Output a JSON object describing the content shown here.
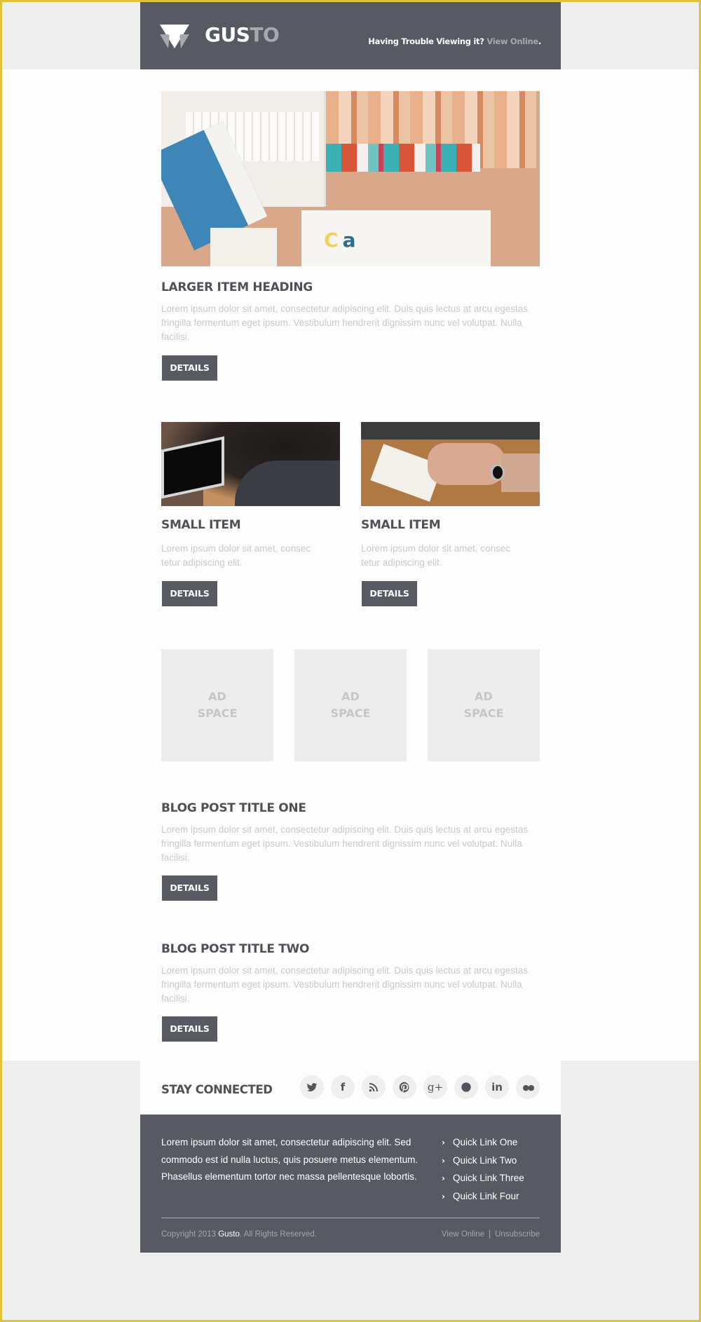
{
  "header": {
    "brand_bright": "GUS",
    "brand_dim": "TO",
    "trouble_text": "Having Trouble Viewing it?",
    "view_online_link": "View Online",
    "trailing_period": "."
  },
  "hero": {
    "heading": "LARGER ITEM HEADING",
    "body": "Lorem ipsum dolor sit amet, consectetur adipiscing elit. Duis quis lectus at arcu egestas fringilla fermentum eget ipsum. Vestibulum hendrerit dignissim nunc vel volutpat. Nulla facilisi.",
    "button": "DETAILS"
  },
  "small_items": [
    {
      "heading": "SMALL ITEM",
      "body": "Lorem ipsum dolor sit amet, consec tetur adipiscing elit.",
      "button": "DETAILS"
    },
    {
      "heading": "SMALL ITEM",
      "body": "Lorem ipsum dolor sit amet, consec tetur adipiscing elit.",
      "button": "DETAILS"
    }
  ],
  "ads": [
    {
      "line1": "AD",
      "line2": "SPACE"
    },
    {
      "line1": "AD",
      "line2": "SPACE"
    },
    {
      "line1": "AD",
      "line2": "SPACE"
    }
  ],
  "blog_posts": [
    {
      "title": "BLOG POST TITLE ONE",
      "body": "Lorem ipsum dolor sit amet, consectetur adipiscing elit. Duis quis lectus at arcu egestas fringilla fermentum eget ipsum. Vestibulum hendrerit dignissim nunc vel volutpat. Nulla facilisi.",
      "button": "DETAILS"
    },
    {
      "title": "BLOG POST TITLE TWO",
      "body": "Lorem ipsum dolor sit amet, consectetur adipiscing elit. Duis quis lectus at arcu egestas fringilla fermentum eget ipsum. Vestibulum hendrerit dignissim nunc vel volutpat. Nulla facilisi.",
      "button": "DETAILS"
    }
  ],
  "social": {
    "heading": "STAY CONNECTED",
    "icons": [
      "twitter-icon",
      "facebook-icon",
      "rss-icon",
      "pinterest-icon",
      "google-plus-icon",
      "dribbble-icon",
      "linkedin-icon",
      "flickr-icon"
    ],
    "facebook_glyph": "f",
    "google_glyph": "g+",
    "linkedin_glyph": "in",
    "flickr_glyph": "●●"
  },
  "footer": {
    "about": "Lorem ipsum dolor sit amet, consectetur adipiscing elit. Sed commodo est id nulla luctus, quis posuere metus elementum. Phasellus elementum tortor nec massa pellentesque lobortis.",
    "quick_links": [
      "Quick Link One",
      "Quick Link Two",
      "Quick Link Three",
      "Quick Link Four"
    ],
    "chevron": "›",
    "copyright_prefix": "Copyright 2013",
    "copyright_brand": "Gusto",
    "copyright_suffix": ". All Rights Reserved.",
    "view_online": "View Online",
    "separator": "|",
    "unsubscribe": "Unsubscribe"
  },
  "colors": {
    "header_bg": "#585a63",
    "page_bg": "#eeeeee",
    "content_bg": "#fdfdfd",
    "frame_border": "#dfc33a",
    "heading": "#4f5157",
    "body_text": "#c9c9cc",
    "ad_bg": "#ededed"
  }
}
